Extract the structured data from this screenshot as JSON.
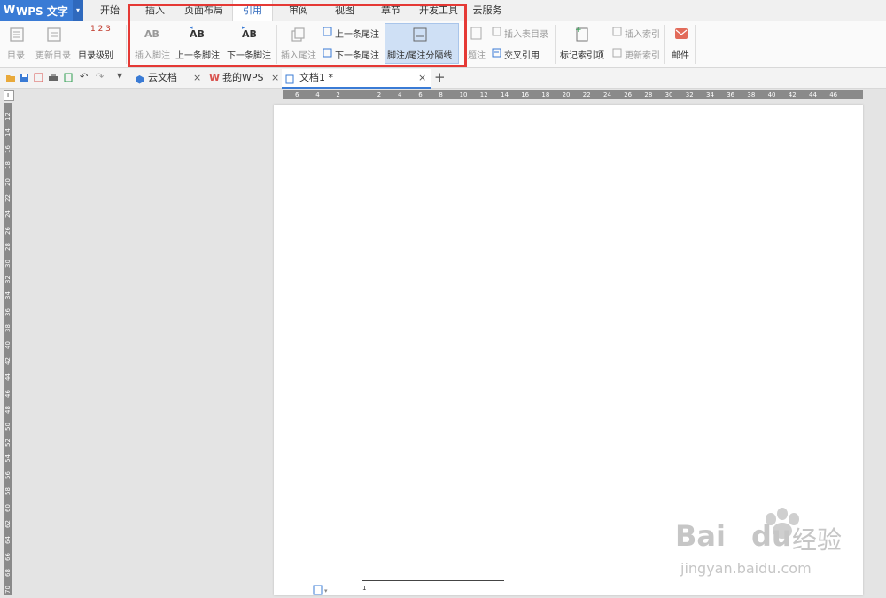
{
  "app": {
    "logo": "W",
    "name": "WPS 文字",
    "menu_arrow": "▾"
  },
  "menu": [
    "开始",
    "插入",
    "页面布局",
    "引用",
    "审阅",
    "视图",
    "章节",
    "开发工具",
    "云服务"
  ],
  "ribbon": {
    "toc": "目录",
    "update_toc": "更新目录",
    "toc_level": "目录级别",
    "insert_footnote": "插入脚注",
    "prev_footnote": "上一条脚注",
    "next_footnote": "下一条脚注",
    "insert_endnote": "插入尾注",
    "prev_endnote": "上一条尾注",
    "next_endnote": "下一条尾注",
    "separator_line": "脚注/尾注分隔线",
    "caption_partial": "题注",
    "insert_table_of_figures": "插入表目录",
    "cross_reference": "交叉引用",
    "mark_index": "标记索引项",
    "insert_index": "插入索引",
    "update_index": "更新索引",
    "mail": "邮件",
    "icon_ab": "AB",
    "icon_ab_sup": "1",
    "icon_toc_level": "1 2 3"
  },
  "tabs": [
    {
      "label": "云文档",
      "close": "×"
    },
    {
      "label": "我的WPS",
      "close": "×"
    },
    {
      "label": "文档1 *",
      "close": "×"
    }
  ],
  "new_tab": "+",
  "ruler": {
    "h": [
      "6",
      "4",
      "2",
      "",
      "2",
      "4",
      "6",
      "8",
      "10",
      "12",
      "14",
      "16",
      "18",
      "20",
      "22",
      "24",
      "26",
      "28",
      "30",
      "32",
      "34",
      "36",
      "38",
      "40",
      "42",
      "44",
      "46"
    ],
    "v": [
      "12",
      "14",
      "16",
      "18",
      "20",
      "22",
      "24",
      "26",
      "28",
      "30",
      "32",
      "34",
      "36",
      "38",
      "40",
      "42",
      "44",
      "46",
      "48",
      "50",
      "52",
      "54",
      "56",
      "58",
      "60",
      "62",
      "64",
      "66",
      "68",
      "70"
    ]
  },
  "footnote_number": "1",
  "watermark": {
    "text1": "Bai",
    "text2": "du",
    "text3": "经验",
    "url": "jingyan.baidu.com"
  }
}
